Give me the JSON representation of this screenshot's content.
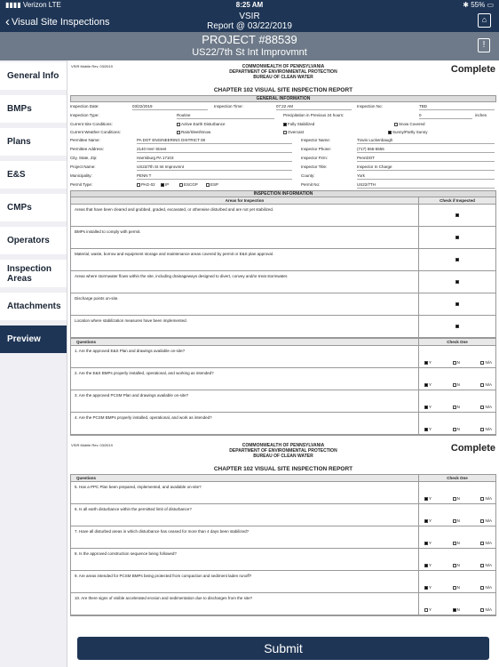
{
  "status": {
    "carrier": "Verizon",
    "network": "LTE",
    "time": "8:25 AM",
    "battery": "55%"
  },
  "nav": {
    "back_label": "Visual Site Inspections",
    "title": "VSIR",
    "subtitle": "Report @ 03/22/2019"
  },
  "project": {
    "number": "PROJECT #88539",
    "name": "US22/7th St Int Improvmnt"
  },
  "sidebar": [
    "General Info",
    "BMPs",
    "Plans",
    "E&S",
    "CMPs",
    "Operators",
    "Inspection Areas",
    "Attachments",
    "Preview"
  ],
  "doc": {
    "rev": "VSIR Mobile Rev. 03/2019",
    "agency": [
      "COMMONWEALTH OF PENNSYLVANIA",
      "DEPARTMENT OF ENVIRONMENTAL PROTECTION",
      "BUREAU OF CLEAN WATER"
    ],
    "complete": "Complete",
    "title": "CHAPTER 102 VISUAL SITE INSPECTION REPORT",
    "general_header": "GENERAL INFORMATION",
    "insp_date_label": "Inspection Date:",
    "insp_date": "03/22/2019",
    "insp_time_label": "Inspection Time:",
    "insp_time": "07:22 AM",
    "insp_no_label": "Inspection No:",
    "insp_no": "TBD",
    "insp_type_label": "Inspection Type:",
    "insp_type": "Routine",
    "precip_label": "Precipitation in Previous 24 hours:",
    "precip": "0",
    "precip_unit": "inches",
    "site_cond_label": "Current Site Conditions:",
    "site_cond": [
      {
        "label": "Active Earth Disturbance",
        "on": false
      },
      {
        "label": "Fully Stabilized",
        "on": true
      },
      {
        "label": "Snow Covered",
        "on": false
      }
    ],
    "weather_label": "Current Weather Conditions:",
    "weather": [
      {
        "label": "Rain/Sleet/Snow",
        "on": false
      },
      {
        "label": "Overcast",
        "on": false
      },
      {
        "label": "Sunny/Partly Sunny",
        "on": true
      }
    ],
    "permittee_name_label": "Permittee Name:",
    "permittee_name": "PA DOT ENGINEERING DISTRICT 08",
    "inspector_name_label": "Inspector Name:",
    "inspector_name": "Travis Luckenbaugh",
    "permittee_addr_label": "Permittee Address:",
    "permittee_addr": "2140 Herr Street",
    "inspector_phone_label": "Inspector Phone:",
    "inspector_phone": "(717) 555-5555",
    "csz_label": "City, State, Zip:",
    "csz": "Harrisburg PA 17103",
    "inspector_firm_label": "Inspector Firm:",
    "inspector_firm": "PennDOT",
    "project_name_label": "Project Name:",
    "project_name": "US22/7th St Int Improvmnt",
    "inspector_title_label": "Inspector Title:",
    "inspector_title": "Inspector In Charge",
    "municipality_label": "Municipality:",
    "municipality": "PENN T",
    "county_label": "County:",
    "county": "York",
    "permit_type_label": "Permit Type:",
    "permit_types": [
      {
        "label": "PAG-02",
        "on": false
      },
      {
        "label": "IP",
        "on": true
      },
      {
        "label": "ESCGP",
        "on": false
      },
      {
        "label": "ESP",
        "on": false
      }
    ],
    "permit_no_label": "Permit No:",
    "permit_no": "US22/7TH",
    "inspection_header": "INSPECTION INFORMATION",
    "areas_col": "Areas for Inspection",
    "check_col": "Check if Inspected",
    "areas": [
      "Areas that have been cleared and grubbed, graded, excavated, or otherwise disturbed and are not yet stabilized.",
      "BMPs installed to comply with permit.",
      "Material, waste, borrow and equipment storage and maintenance areas covered by permit or E&S plan approval.",
      "Areas where stormwater flows within the site, including drainageways designed to divert, convey and/or treat stormwater.",
      "Discharge points on-site.",
      "Location where stabilization measures have been implemented."
    ],
    "questions_col": "Questions",
    "check_one_col": "Check One",
    "opt_y": "Y",
    "opt_n": "N",
    "opt_na": "N/A",
    "questions1": [
      {
        "text": "1.   Are the approved E&S Plan and drawings available on-site?",
        "ans": "Y"
      },
      {
        "text": "2.   Are the E&S BMPs properly installed, operational, and working as intended?",
        "ans": "Y"
      },
      {
        "text": "3.   Are the approved PCSM Plan and drawings available on-site?",
        "ans": "Y"
      },
      {
        "text": "4.   Are the PCSM BMPs properly installed, operational, and work as intended?",
        "ans": "Y"
      }
    ],
    "questions2": [
      {
        "text": "5.   Has a PPC Plan been prepared, implemented, and available on-site?",
        "ans": "Y"
      },
      {
        "text": "6.   Is all earth disturbance within the permitted limit of disturbance?",
        "ans": "Y"
      },
      {
        "text": "7.   Have all disturbed areas in which disturbance has ceased for more than 4 days been stabilized?",
        "ans": "Y"
      },
      {
        "text": "8.   Is the approved construction sequence being followed?",
        "ans": "Y"
      },
      {
        "text": "9.   Are areas intended for PCSM BMPs being protected from compaction and sediment laden runoff?",
        "ans": "Y"
      },
      {
        "text": "10.  Are there signs of visible accelerated erosion and sedimentation due to discharges from the site?",
        "ans": "N"
      }
    ]
  },
  "submit_label": "Submit"
}
